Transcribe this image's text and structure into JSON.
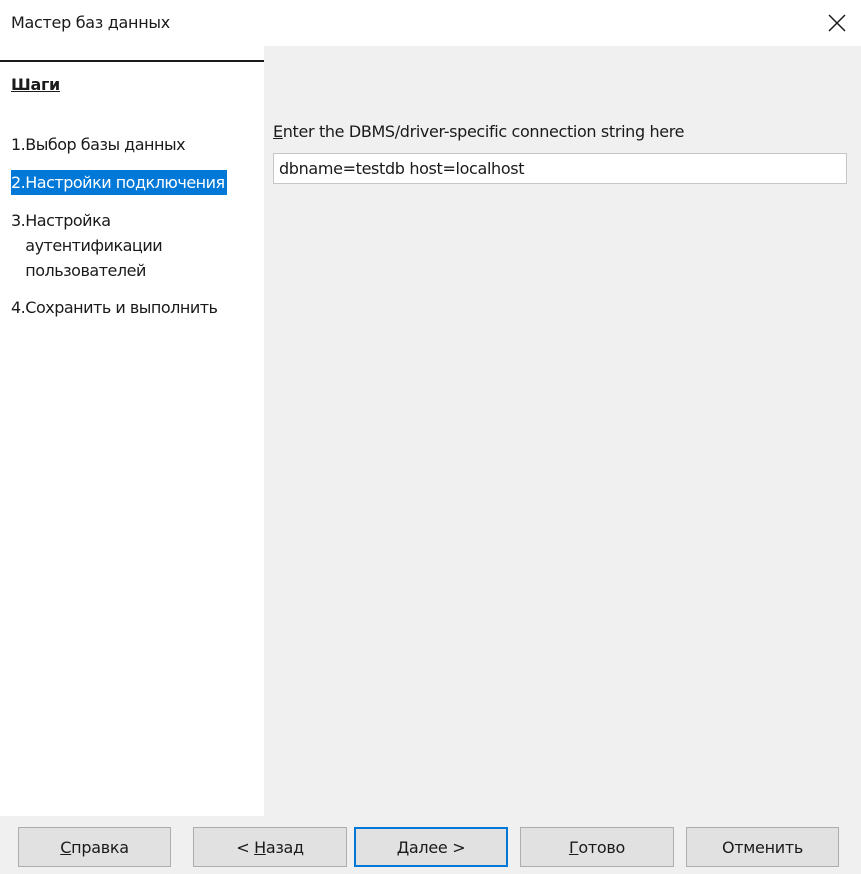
{
  "window": {
    "title": "Мастер баз данных"
  },
  "steps": {
    "heading": "Шаги",
    "items": [
      {
        "num": "1.",
        "label": "Выбор базы данных",
        "active": false
      },
      {
        "num": "2.",
        "label": "Настройки подключения",
        "active": true
      },
      {
        "num": "3.",
        "label": "Настройка аутентификации пользователей",
        "active": false
      },
      {
        "num": "4.",
        "label": "Сохранить и выполнить",
        "active": false
      }
    ]
  },
  "connection": {
    "label_first": "E",
    "label_rest": "nter the DBMS/driver-specific connection string here",
    "value": "dbname=testdb host=localhost"
  },
  "buttons": {
    "help": {
      "mnemonic": "С",
      "rest": "правка"
    },
    "back": {
      "prefix": "< ",
      "mnemonic": "Н",
      "rest": "азад"
    },
    "next": {
      "mnemonic": "Д",
      "rest": "алее >"
    },
    "finish": {
      "mnemonic": "Г",
      "rest": "отово"
    },
    "cancel": {
      "label": "Отменить"
    }
  },
  "colors": {
    "accent": "#0078d7",
    "panel": "#f0f0f0",
    "button_face": "#e1e1e1"
  }
}
